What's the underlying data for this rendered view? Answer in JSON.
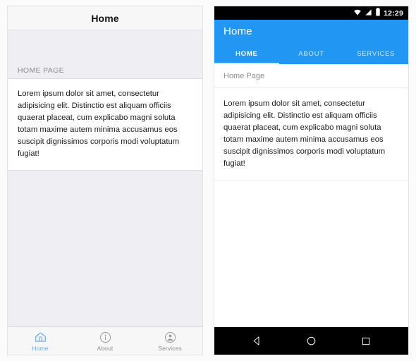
{
  "left_panel": {
    "navbar": {
      "title": "Home"
    },
    "section_header": "HOME PAGE",
    "body_text": "Lorem ipsum dolor sit amet, consectetur adipisicing elit. Distinctio est aliquam officiis quaerat placeat, cum explicabo magni soluta totam maxime autem minima accusamus eos suscipit dignissimos corporis modi voluptatum fugiat!",
    "tabs": [
      {
        "label": "Home",
        "icon": "home-icon",
        "active": true
      },
      {
        "label": "About",
        "icon": "info-icon",
        "active": false
      },
      {
        "label": "Services",
        "icon": "contacts-icon",
        "active": false
      }
    ],
    "colors": {
      "active_tab": "#6aa9f4",
      "inactive_tab": "#8e8e93",
      "background": "#eeeef3"
    }
  },
  "right_panel": {
    "status_bar": {
      "clock": "12:29",
      "icons": [
        "wifi-icon",
        "signal-icon",
        "battery-icon"
      ]
    },
    "appbar": {
      "title": "Home"
    },
    "tabs": [
      {
        "label": "HOME",
        "active": true
      },
      {
        "label": "ABOUT",
        "active": false
      },
      {
        "label": "SERVICES",
        "active": false
      }
    ],
    "subheader": "Home Page",
    "body_text": "Lorem ipsum dolor sit amet, consectetur adipisicing elit. Distinctio est aliquam officiis quaerat placeat, cum explicabo magni soluta totam maxime autem minima accusamus eos suscipit dignissimos corporis modi voluptatum fugiat!",
    "nav_bar": {
      "back": "back-icon",
      "home": "home-circle-icon",
      "recents": "recents-square-icon"
    },
    "colors": {
      "accent": "#2196f3",
      "indicator": "#cfe7fb",
      "system_bar": "#000000"
    }
  }
}
